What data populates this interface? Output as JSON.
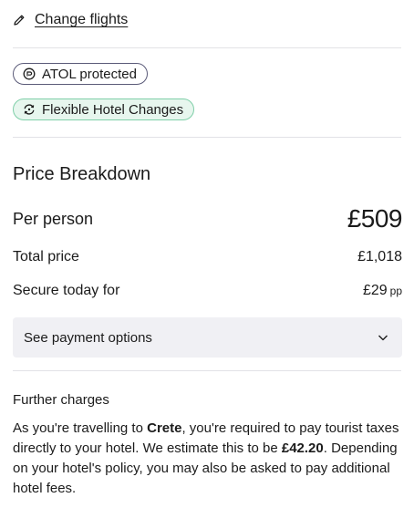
{
  "change_flights": {
    "label": "Change flights",
    "icon": "pencil-icon"
  },
  "badges": [
    {
      "label": "ATOL protected",
      "icon": "atol-icon",
      "border_color": "#5a5a78"
    },
    {
      "label": "Flexible Hotel Changes",
      "icon": "flexible-icon",
      "border_color": "#7fcfa8",
      "bg_color": "#e7f6ee"
    }
  ],
  "price_breakdown": {
    "title": "Price Breakdown",
    "per_person_label": "Per person",
    "per_person_value": "£509",
    "total_label": "Total price",
    "total_value": "£1,018",
    "secure_label": "Secure today for",
    "secure_value": "£29",
    "secure_unit": "pp",
    "payment_options_label": "See payment options"
  },
  "further_charges": {
    "title": "Further charges",
    "text_1": "As you're travelling to ",
    "destination": "Crete",
    "text_2": ", you're required to pay tourist taxes directly to your hotel. We estimate this to be ",
    "amount": "£42.20",
    "text_3": ". Depending on your hotel's policy, you may also be asked to pay additional hotel fees."
  }
}
